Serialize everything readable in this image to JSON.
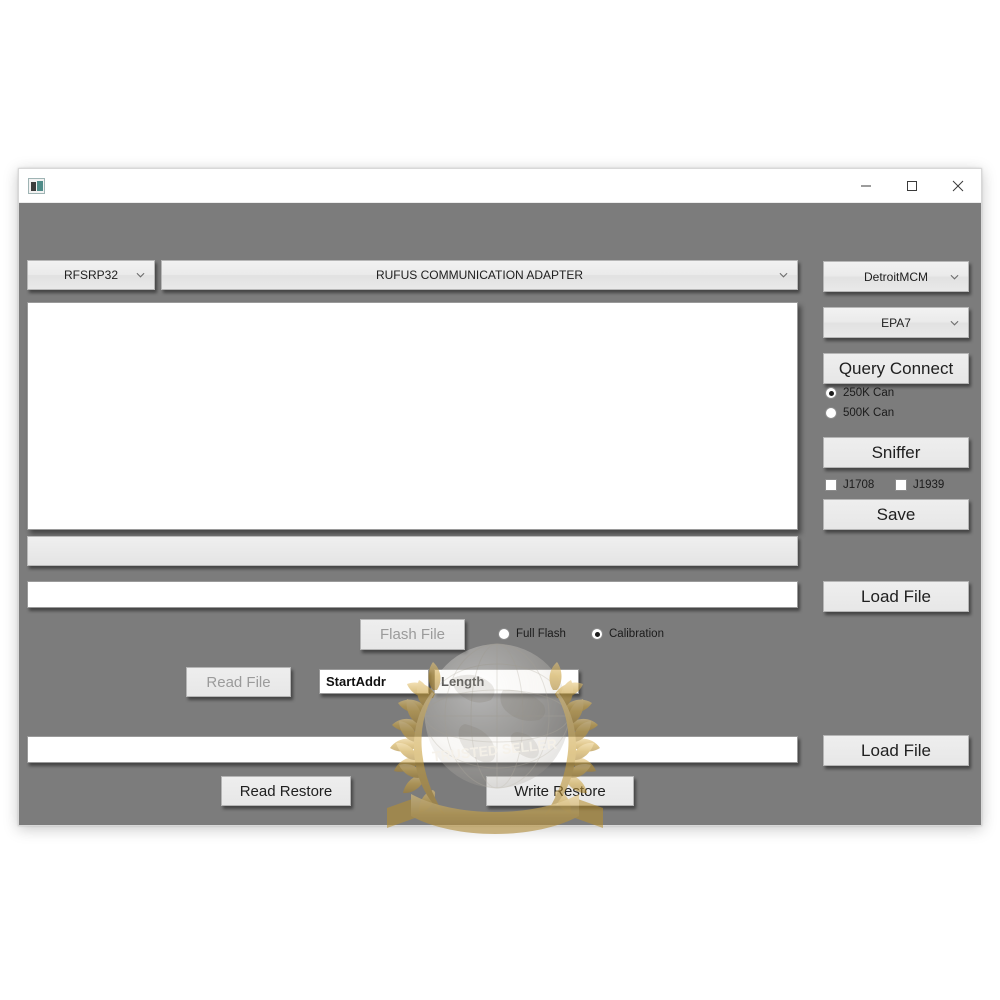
{
  "window": {
    "title": "",
    "icon": "app-icon",
    "controls": {
      "minimize": "—",
      "maximize": "□",
      "close": "✕"
    }
  },
  "toolbar": {
    "device_combo": {
      "value": "RFSRP32",
      "chevron": "chevron-down-icon"
    },
    "adapter_combo": {
      "value": "RUFUS COMMUNICATION ADAPTER",
      "chevron": "chevron-down-icon"
    }
  },
  "right_panel": {
    "ecu_combo": {
      "value": "DetroitMCM",
      "chevron": "chevron-down-icon"
    },
    "epa_combo": {
      "value": "EPA7",
      "chevron": "chevron-down-icon"
    },
    "query_connect_label": "Query Connect",
    "can_speed": {
      "options": [
        {
          "label": "250K Can",
          "selected": true
        },
        {
          "label": "500K Can",
          "selected": false
        }
      ]
    },
    "sniffer_label": "Sniffer",
    "protocols": [
      {
        "label": "J1708",
        "checked": false
      },
      {
        "label": "J1939",
        "checked": false
      }
    ],
    "save_label": "Save",
    "load_file_flash_label": "Load File",
    "load_file_restore_label": "Load File"
  },
  "main": {
    "log_value": "",
    "progress_value": "",
    "flash_path_value": "",
    "restore_path_value": "",
    "flash_file_label": "Flash File",
    "read_file_label": "Read File",
    "read_restore_label": "Read Restore",
    "write_restore_label": "Write Restore",
    "flash_mode": {
      "options": [
        {
          "label": "Full Flash",
          "selected": false
        },
        {
          "label": "Calibration",
          "selected": true
        }
      ]
    },
    "start_addr": {
      "value": "StartAddr",
      "placeholder": "StartAddr"
    },
    "length": {
      "value": "Length",
      "placeholder": "Length"
    }
  },
  "watermark": {
    "banner_text": "TRUSTED SELLER",
    "gold": "#c9a03c",
    "gold_light": "#e3c073"
  }
}
